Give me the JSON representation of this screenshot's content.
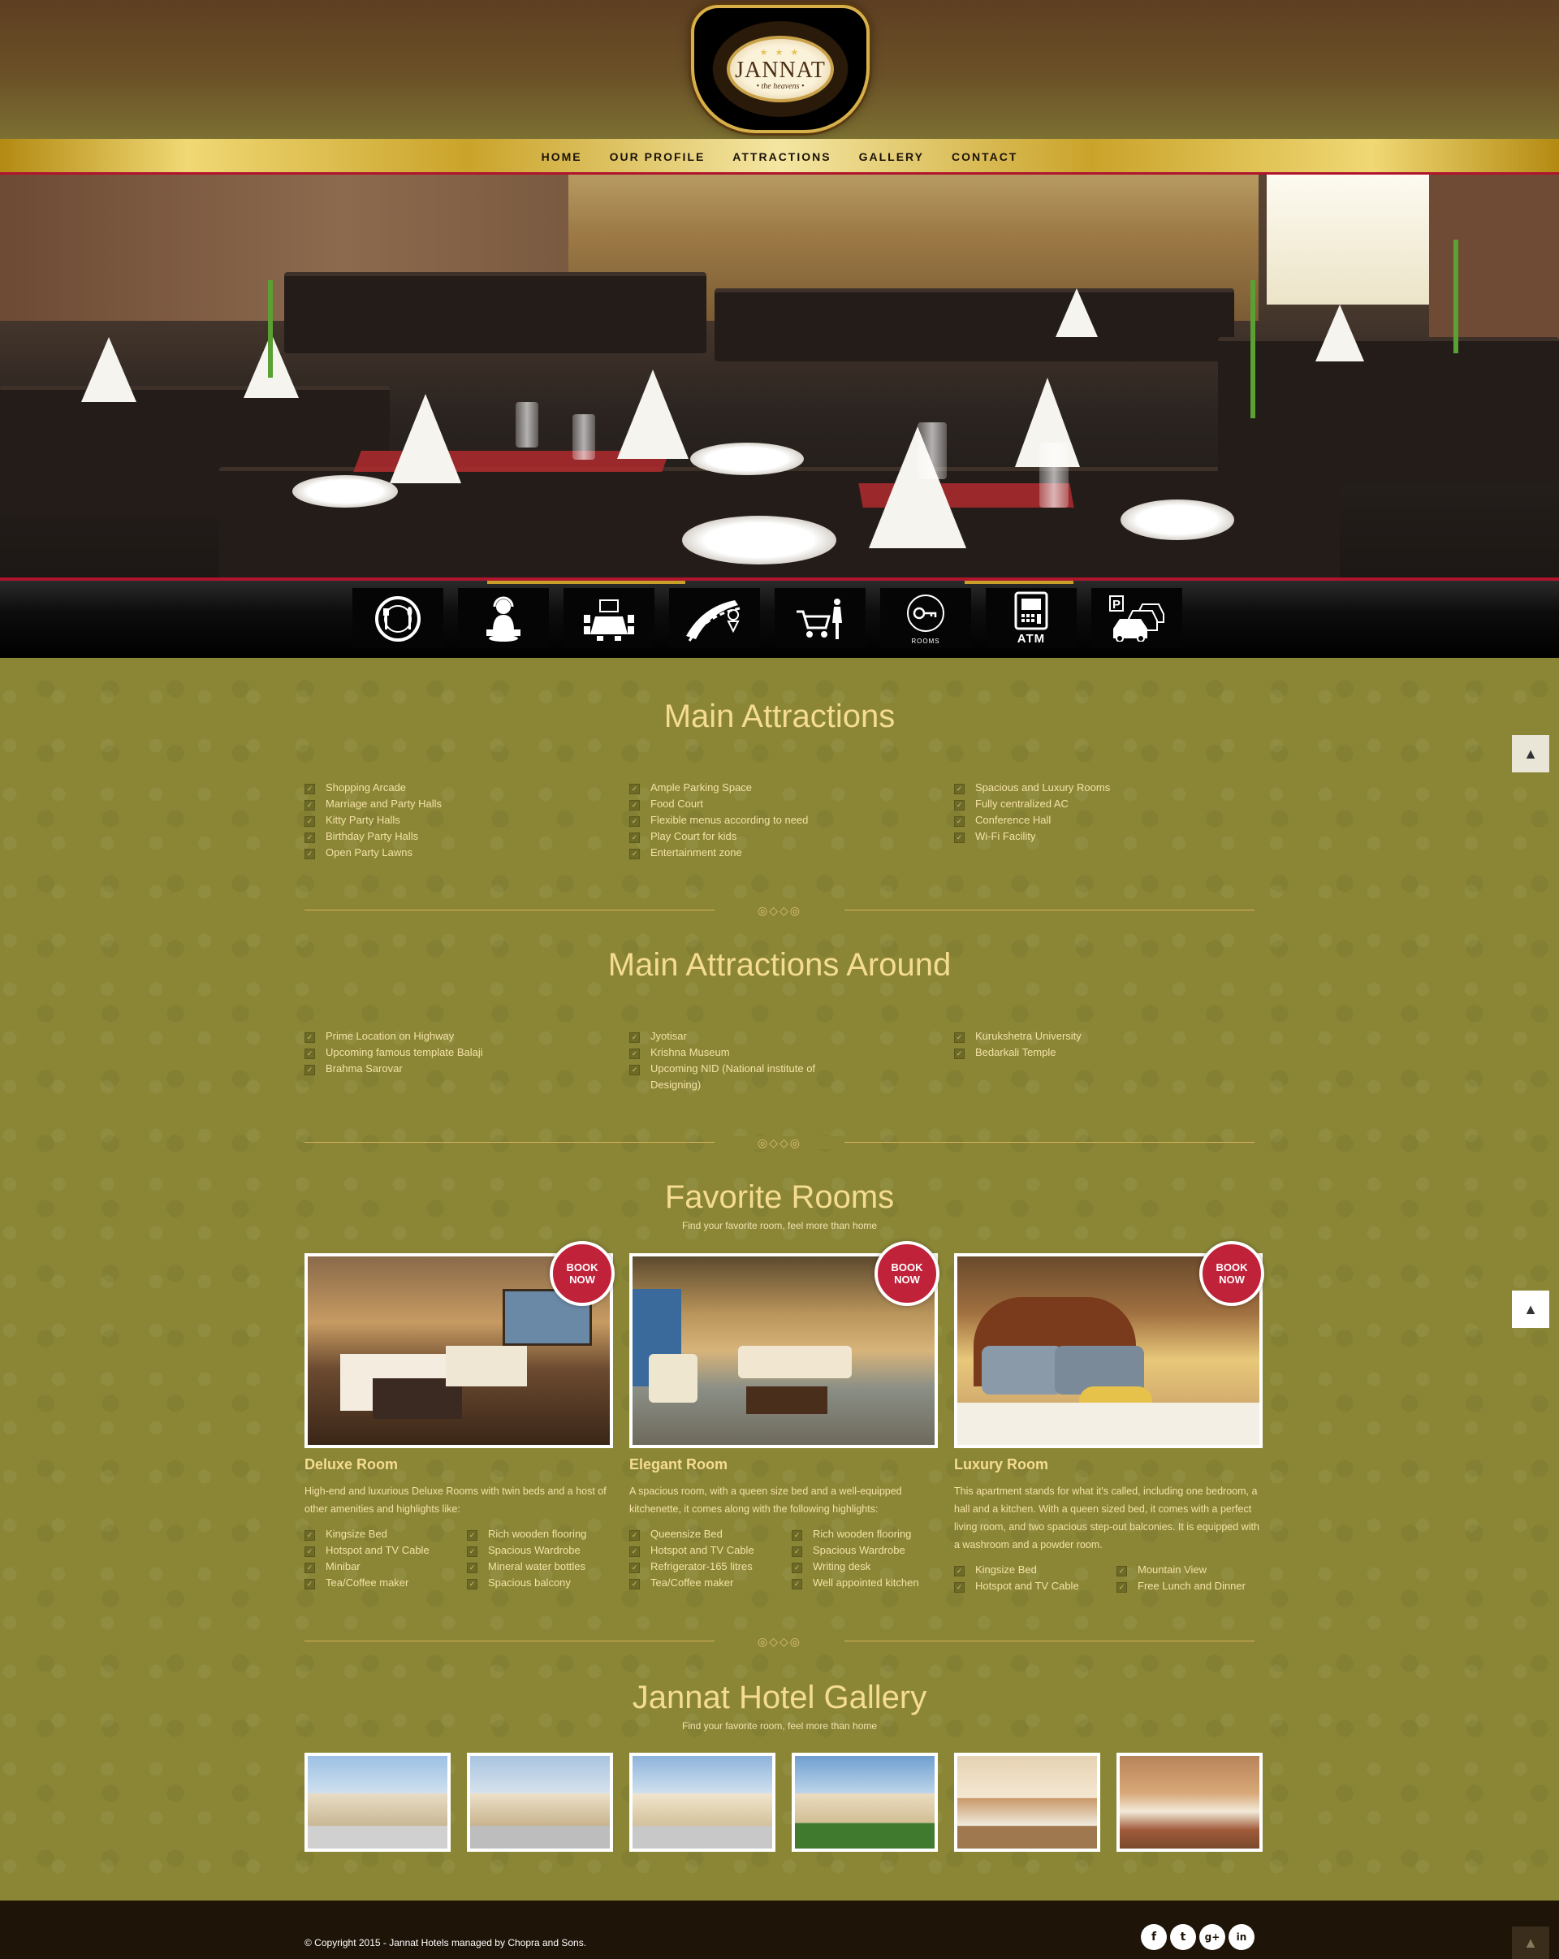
{
  "brand": {
    "name": "JANNAT",
    "tagline": "• the heavens •",
    "stars": "★ ★ ★"
  },
  "nav": {
    "items": [
      "HOME",
      "OUR PROFILE",
      "ATTRACTIONS",
      "GALLERY",
      "CONTACT"
    ]
  },
  "amenities": [
    {
      "icon": "restaurant-icon",
      "label": ""
    },
    {
      "icon": "dj-icon",
      "label": ""
    },
    {
      "icon": "conference-icon",
      "label": ""
    },
    {
      "icon": "highway-location-icon",
      "label": ""
    },
    {
      "icon": "shopping-icon",
      "label": ""
    },
    {
      "icon": "rooms-key-icon",
      "label": "ROOMS"
    },
    {
      "icon": "atm-icon",
      "label": "ATM"
    },
    {
      "icon": "parking-icon",
      "label": "P"
    }
  ],
  "main_attractions": {
    "title": "Main Attractions",
    "col1": [
      "Shopping Arcade",
      "Marriage and Party Halls",
      "Kitty Party Halls",
      "Birthday Party Halls",
      "Open Party Lawns"
    ],
    "col2": [
      "Ample Parking Space",
      "Food Court",
      "Flexible menus according to need",
      "Play Court for kids",
      "Entertainment zone"
    ],
    "col3": [
      "Spacious and Luxury Rooms",
      "Fully centralized AC",
      "Conference Hall",
      "Wi-Fi Facility"
    ]
  },
  "attractions_around": {
    "title": "Main Attractions Around",
    "col1": [
      "Prime Location on Highway",
      "Upcoming famous template Balaji",
      "Brahma Sarovar"
    ],
    "col2": [
      "Jyotisar",
      "Krishna Museum",
      "Upcoming NID (National institute of Designing)"
    ],
    "col3": [
      "Kurukshetra University",
      "Bedarkali Temple"
    ]
  },
  "rooms": {
    "title": "Favorite Rooms",
    "subtitle": "Find your favorite room, feel more than home",
    "book_line1": "BOOK",
    "book_line2": "NOW",
    "items": [
      {
        "name": "Deluxe Room",
        "desc": "High-end and luxurious Deluxe Rooms with twin beds and a host of other amenities and highlights like:",
        "col1": [
          "Kingsize Bed",
          "Hotspot and TV Cable",
          "Minibar",
          "Tea/Coffee maker"
        ],
        "col2": [
          "Rich wooden flooring",
          "Spacious Wardrobe",
          "Mineral water bottles",
          "Spacious balcony"
        ]
      },
      {
        "name": "Elegant Room",
        "desc": "A spacious room, with a queen size bed and a well-equipped kitchenette, it comes along with the following highlights:",
        "col1": [
          "Queensize Bed",
          "Hotspot and TV Cable",
          "Refrigerator-165 litres",
          "Tea/Coffee maker"
        ],
        "col2": [
          "Rich wooden flooring",
          "Spacious Wardrobe",
          "Writing desk",
          "Well appointed kitchen"
        ]
      },
      {
        "name": "Luxury Room",
        "desc": "This apartment stands for what it's called, including one bedroom, a hall and a kitchen. With a queen sized bed, it comes with a perfect living room, and two spacious step-out balconies. It is equipped with a washroom and a powder room.",
        "col1": [
          "Kingsize Bed",
          "Hotspot and TV Cable"
        ],
        "col2": [
          "Mountain View",
          "Free Lunch and Dinner"
        ]
      }
    ]
  },
  "gallery": {
    "title": "Jannat Hotel Gallery",
    "subtitle": "Find your favorite room, feel more than home"
  },
  "footer": {
    "copyright": "© Copyright 2015 - Jannat Hotels managed by Chopra and Sons.",
    "social": [
      "f",
      "t",
      "g+",
      "in"
    ]
  },
  "colors": {
    "accent_red": "#c0223a",
    "gold": "#f6dc90",
    "olive_bg": "#8a8636"
  }
}
